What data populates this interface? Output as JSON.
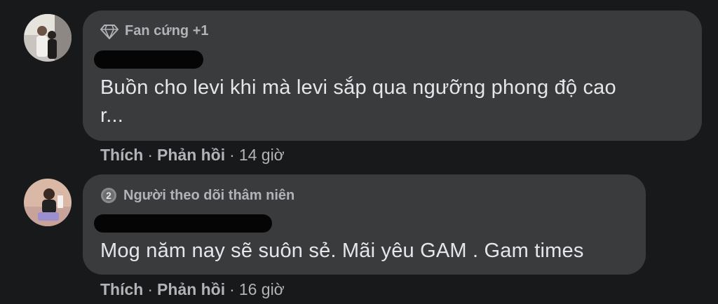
{
  "comments": [
    {
      "badge": "Fan cứng +1",
      "badge_icon": "diamond-icon",
      "text_line1": "Buồn cho levi khi mà levi sắp qua ngưỡng phong độ cao",
      "text_line2": "r...",
      "like_label": "Thích",
      "reply_label": "Phản hồi",
      "time": "14 giờ"
    },
    {
      "badge": "Người theo dõi thâm niên",
      "badge_icon": "rank-2-badge-icon",
      "badge_number": "2",
      "text_line1": "Mog năm nay sẽ suôn sẻ. Mãi yêu GAM . Gam times",
      "like_label": "Thích",
      "reply_label": "Phản hồi",
      "time": "16 giờ"
    }
  ],
  "separator": "·",
  "colors": {
    "background": "#18191a",
    "bubble": "#3a3b3c",
    "primary_text": "#e4e6eb",
    "secondary_text": "#b0b3b8"
  }
}
